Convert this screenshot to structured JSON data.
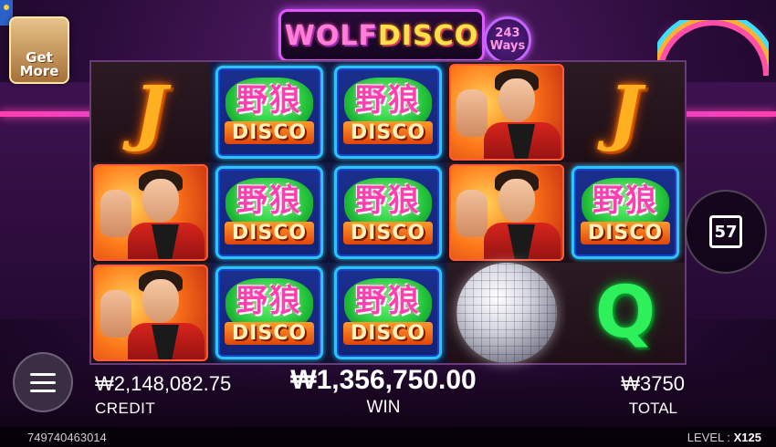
{
  "game": {
    "logo": {
      "part1": "WOLF",
      "part2": "DISCO"
    },
    "ways": {
      "number": "243",
      "label": "Ways"
    }
  },
  "get_more": {
    "line1": "Get",
    "line2": "More"
  },
  "reels": {
    "columns": [
      {
        "style": "dark",
        "symbols": [
          {
            "kind": "letter",
            "text": "J",
            "color": "orange"
          },
          {
            "kind": "man"
          },
          {
            "kind": "man"
          }
        ]
      },
      {
        "style": "blue",
        "symbols": [
          {
            "kind": "wild",
            "cn": "野狼",
            "text": "DISCO"
          },
          {
            "kind": "wild",
            "cn": "野狼",
            "text": "DISCO"
          },
          {
            "kind": "wild",
            "cn": "野狼",
            "text": "DISCO"
          }
        ]
      },
      {
        "style": "blue",
        "symbols": [
          {
            "kind": "wild",
            "cn": "野狼",
            "text": "DISCO"
          },
          {
            "kind": "wild",
            "cn": "野狼",
            "text": "DISCO"
          },
          {
            "kind": "wild",
            "cn": "野狼",
            "text": "DISCO"
          }
        ]
      },
      {
        "style": "dark",
        "symbols": [
          {
            "kind": "man"
          },
          {
            "kind": "man"
          },
          {
            "kind": "ball"
          }
        ]
      },
      {
        "style": "dark",
        "symbols": [
          {
            "kind": "letter",
            "text": "J",
            "color": "orange"
          },
          {
            "kind": "wild",
            "cn": "野狼",
            "text": "DISCO"
          },
          {
            "kind": "letter",
            "text": "Q",
            "color": "green"
          }
        ]
      }
    ]
  },
  "counter": "57",
  "status": {
    "credit_value": "₩2,148,082.75",
    "credit_label": "CREDIT",
    "win_value": "₩1,356,750.00",
    "win_label": "WIN",
    "total_value": "₩3750",
    "total_label": "TOTAL"
  },
  "footer": {
    "round_id": "749740463014",
    "level_label": "LEVEL :",
    "level_value": "X125"
  }
}
